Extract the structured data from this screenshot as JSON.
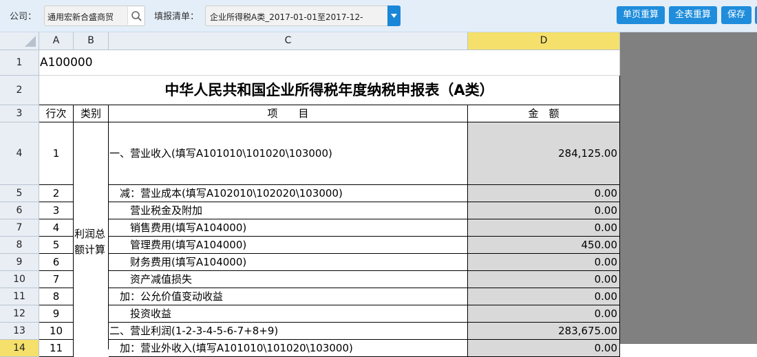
{
  "toolbar": {
    "company_label": "公司：",
    "company_value": "通用宏新合盛商贸",
    "list_label": "填报清单：",
    "list_value": "企业所得税A类_2017-01-01至2017-12-",
    "buttons": [
      "单页重算",
      "全表重算",
      "保存",
      "打"
    ]
  },
  "columns": [
    "A",
    "B",
    "C",
    "D"
  ],
  "sheet": {
    "code": "A100000",
    "title": "中华人民共和国企业所得税年度纳税申报表（A类）",
    "headers": {
      "line": "行次",
      "category": "类别",
      "item": "项　　目",
      "amount": "金　额"
    },
    "category_profit": "利润总额计算",
    "rows": [
      {
        "rownum": "4",
        "line": "1",
        "item": "一、营业收入(填写A101010\\101020\\103000)",
        "amount": "284,125.00"
      },
      {
        "rownum": "5",
        "line": "2",
        "item": "　减：营业成本(填写A102010\\102020\\103000)",
        "amount": "0.00"
      },
      {
        "rownum": "6",
        "line": "3",
        "item": "　　营业税金及附加",
        "amount": "0.00"
      },
      {
        "rownum": "7",
        "line": "4",
        "item": "　　销售费用(填写A104000)",
        "amount": "0.00"
      },
      {
        "rownum": "8",
        "line": "5",
        "item": "　　管理费用(填写A104000)",
        "amount": "450.00"
      },
      {
        "rownum": "9",
        "line": "6",
        "item": "　　财务费用(填写A104000)",
        "amount": "0.00"
      },
      {
        "rownum": "10",
        "line": "7",
        "item": "　　资产减值损失",
        "amount": "0.00"
      },
      {
        "rownum": "11",
        "line": "8",
        "item": "　加：公允价值变动收益",
        "amount": "0.00"
      },
      {
        "rownum": "12",
        "line": "9",
        "item": "　　投资收益",
        "amount": "0.00"
      },
      {
        "rownum": "13",
        "line": "10",
        "item": "二、营业利润(1-2-3-4-5-6-7+8+9)",
        "amount": "283,675.00"
      },
      {
        "rownum": "14",
        "line": "11",
        "item": "　加：营业外收入(填写A101010\\101020\\103000)",
        "amount": "0.00"
      }
    ]
  }
}
